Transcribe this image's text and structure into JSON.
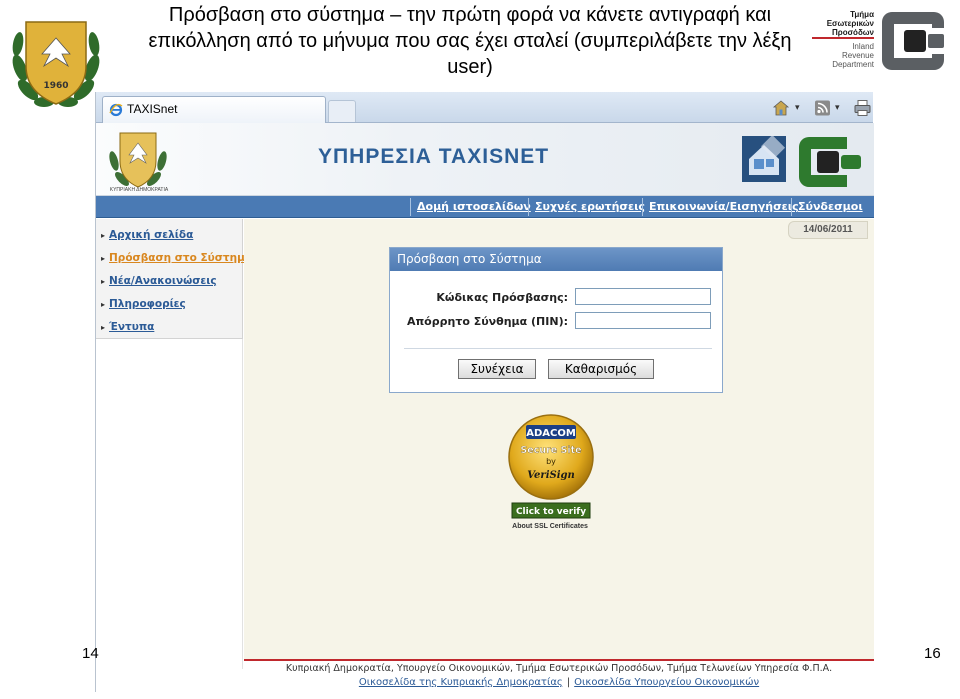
{
  "slide": {
    "title": "Πρόσβαση στο σύστημα – την πρώτη φορά να κάνετε αντιγραφή και επικόλληση από το μήνυμα που σας έχει σταλεί (συμπεριλάβετε την λέξη user)",
    "date_fragment": "14",
    "page_number": "16",
    "emblem_year": "1960"
  },
  "department": {
    "gr_lines": [
      "Τμήμα",
      "Εσωτερικών",
      "Προσόδων"
    ],
    "en_lines": [
      "Inland",
      "Revenue",
      "Department"
    ]
  },
  "browser": {
    "tab_title": "TAXISnet",
    "icons": [
      "home-icon",
      "feeds-icon",
      "print-icon"
    ]
  },
  "site": {
    "title": "ΥΠΗΡΕΣΙΑ TAXISNET",
    "emblem_caption": "ΚΥΠΡΙΑΚΗ ΔΗΜΟΚΡΑΤΙΑ",
    "nav": [
      "Δομή ιστοσελίδων",
      "Συχνές ερωτήσεις",
      "Επικοινωνία/Εισηγήσεις",
      "Σύνδεσμοι"
    ],
    "sidebar": [
      "Αρχική σελίδα",
      "Πρόσβαση στο Σύστημα",
      "Νέα/Ανακοινώσεις",
      "Πληροφορίες",
      "Έντυπα"
    ],
    "active_sidebar_index": 1,
    "date": "14/06/2011"
  },
  "login": {
    "heading": "Πρόσβαση στο Σύστημα",
    "code_label": "Κώδικας Πρόσβασης:",
    "code_value": "",
    "pin_label": "Απόρρητο Σύνθημα (ΠΙΝ):",
    "pin_value": "",
    "continue_button": "Συνέχεια",
    "clear_button": "Καθαρισμός"
  },
  "seal": {
    "brand": "ADACOM",
    "line1": "Secure Site",
    "line2": "by",
    "line3": "VeriSign",
    "cta": "Click to verify",
    "caption": "About SSL Certificates"
  },
  "footer": {
    "line1": "Κυπριακή Δημοκρατία, Υπουργείο Οικονομικών, Τμήμα Εσωτερικών Προσόδων, Τμήμα Τελωνείων Υπηρεσία Φ.Π.Α.",
    "link1": "Οικοσελίδα της Κυπριακής Δημοκρατίας",
    "separator": "|",
    "link2": "Οικοσελίδα Υπουργείου Οικονομικών"
  },
  "colors": {
    "nav_blue": "#4a7ab4",
    "active_orange": "#d9871f",
    "link_blue": "#2b5a96",
    "footer_red": "#c0282d"
  }
}
